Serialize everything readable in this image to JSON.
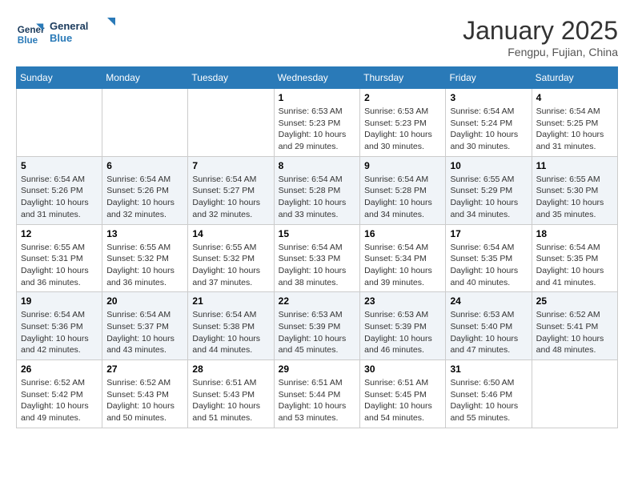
{
  "logo": {
    "line1": "General",
    "line2": "Blue"
  },
  "title": "January 2025",
  "subtitle": "Fengpu, Fujian, China",
  "days_of_week": [
    "Sunday",
    "Monday",
    "Tuesday",
    "Wednesday",
    "Thursday",
    "Friday",
    "Saturday"
  ],
  "weeks": [
    [
      {
        "day": "",
        "info": ""
      },
      {
        "day": "",
        "info": ""
      },
      {
        "day": "",
        "info": ""
      },
      {
        "day": "1",
        "info": "Sunrise: 6:53 AM\nSunset: 5:23 PM\nDaylight: 10 hours and 29 minutes."
      },
      {
        "day": "2",
        "info": "Sunrise: 6:53 AM\nSunset: 5:23 PM\nDaylight: 10 hours and 30 minutes."
      },
      {
        "day": "3",
        "info": "Sunrise: 6:54 AM\nSunset: 5:24 PM\nDaylight: 10 hours and 30 minutes."
      },
      {
        "day": "4",
        "info": "Sunrise: 6:54 AM\nSunset: 5:25 PM\nDaylight: 10 hours and 31 minutes."
      }
    ],
    [
      {
        "day": "5",
        "info": "Sunrise: 6:54 AM\nSunset: 5:26 PM\nDaylight: 10 hours and 31 minutes."
      },
      {
        "day": "6",
        "info": "Sunrise: 6:54 AM\nSunset: 5:26 PM\nDaylight: 10 hours and 32 minutes."
      },
      {
        "day": "7",
        "info": "Sunrise: 6:54 AM\nSunset: 5:27 PM\nDaylight: 10 hours and 32 minutes."
      },
      {
        "day": "8",
        "info": "Sunrise: 6:54 AM\nSunset: 5:28 PM\nDaylight: 10 hours and 33 minutes."
      },
      {
        "day": "9",
        "info": "Sunrise: 6:54 AM\nSunset: 5:28 PM\nDaylight: 10 hours and 34 minutes."
      },
      {
        "day": "10",
        "info": "Sunrise: 6:55 AM\nSunset: 5:29 PM\nDaylight: 10 hours and 34 minutes."
      },
      {
        "day": "11",
        "info": "Sunrise: 6:55 AM\nSunset: 5:30 PM\nDaylight: 10 hours and 35 minutes."
      }
    ],
    [
      {
        "day": "12",
        "info": "Sunrise: 6:55 AM\nSunset: 5:31 PM\nDaylight: 10 hours and 36 minutes."
      },
      {
        "day": "13",
        "info": "Sunrise: 6:55 AM\nSunset: 5:32 PM\nDaylight: 10 hours and 36 minutes."
      },
      {
        "day": "14",
        "info": "Sunrise: 6:55 AM\nSunset: 5:32 PM\nDaylight: 10 hours and 37 minutes."
      },
      {
        "day": "15",
        "info": "Sunrise: 6:54 AM\nSunset: 5:33 PM\nDaylight: 10 hours and 38 minutes."
      },
      {
        "day": "16",
        "info": "Sunrise: 6:54 AM\nSunset: 5:34 PM\nDaylight: 10 hours and 39 minutes."
      },
      {
        "day": "17",
        "info": "Sunrise: 6:54 AM\nSunset: 5:35 PM\nDaylight: 10 hours and 40 minutes."
      },
      {
        "day": "18",
        "info": "Sunrise: 6:54 AM\nSunset: 5:35 PM\nDaylight: 10 hours and 41 minutes."
      }
    ],
    [
      {
        "day": "19",
        "info": "Sunrise: 6:54 AM\nSunset: 5:36 PM\nDaylight: 10 hours and 42 minutes."
      },
      {
        "day": "20",
        "info": "Sunrise: 6:54 AM\nSunset: 5:37 PM\nDaylight: 10 hours and 43 minutes."
      },
      {
        "day": "21",
        "info": "Sunrise: 6:54 AM\nSunset: 5:38 PM\nDaylight: 10 hours and 44 minutes."
      },
      {
        "day": "22",
        "info": "Sunrise: 6:53 AM\nSunset: 5:39 PM\nDaylight: 10 hours and 45 minutes."
      },
      {
        "day": "23",
        "info": "Sunrise: 6:53 AM\nSunset: 5:39 PM\nDaylight: 10 hours and 46 minutes."
      },
      {
        "day": "24",
        "info": "Sunrise: 6:53 AM\nSunset: 5:40 PM\nDaylight: 10 hours and 47 minutes."
      },
      {
        "day": "25",
        "info": "Sunrise: 6:52 AM\nSunset: 5:41 PM\nDaylight: 10 hours and 48 minutes."
      }
    ],
    [
      {
        "day": "26",
        "info": "Sunrise: 6:52 AM\nSunset: 5:42 PM\nDaylight: 10 hours and 49 minutes."
      },
      {
        "day": "27",
        "info": "Sunrise: 6:52 AM\nSunset: 5:43 PM\nDaylight: 10 hours and 50 minutes."
      },
      {
        "day": "28",
        "info": "Sunrise: 6:51 AM\nSunset: 5:43 PM\nDaylight: 10 hours and 51 minutes."
      },
      {
        "day": "29",
        "info": "Sunrise: 6:51 AM\nSunset: 5:44 PM\nDaylight: 10 hours and 53 minutes."
      },
      {
        "day": "30",
        "info": "Sunrise: 6:51 AM\nSunset: 5:45 PM\nDaylight: 10 hours and 54 minutes."
      },
      {
        "day": "31",
        "info": "Sunrise: 6:50 AM\nSunset: 5:46 PM\nDaylight: 10 hours and 55 minutes."
      },
      {
        "day": "",
        "info": ""
      }
    ]
  ]
}
